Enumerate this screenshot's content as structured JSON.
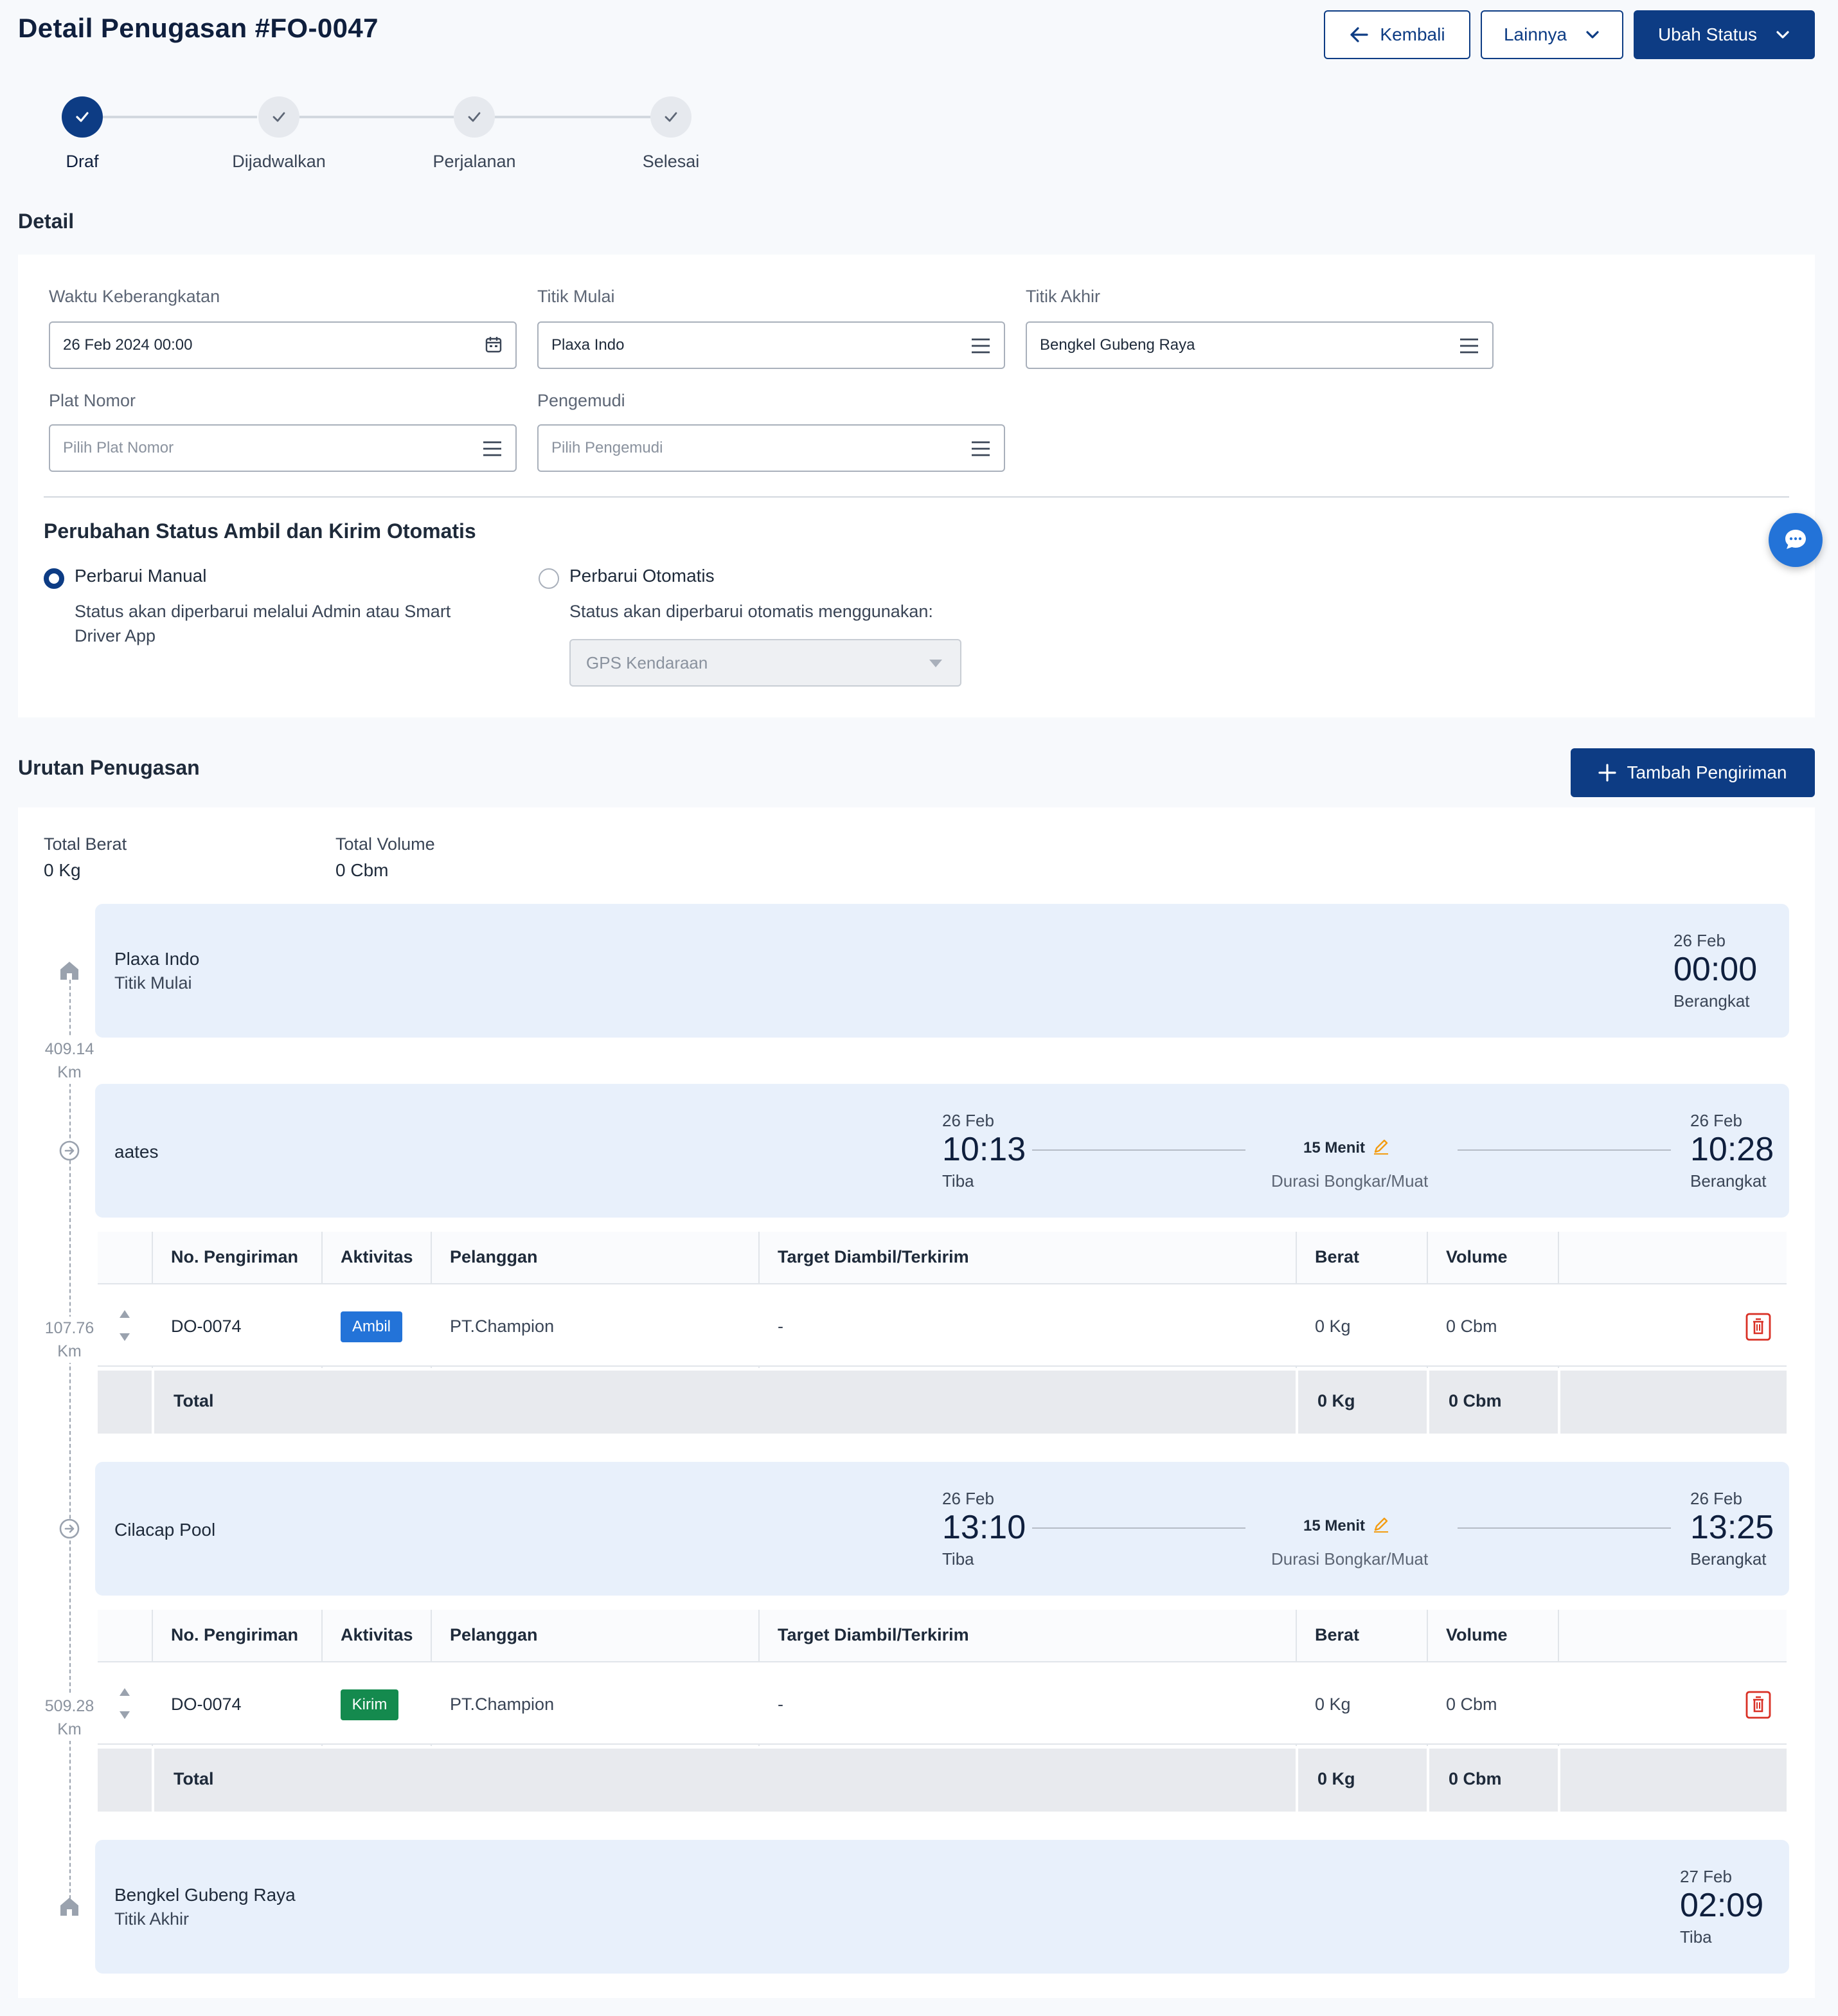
{
  "page": {
    "title": "Detail Penugasan #FO-0047"
  },
  "header_actions": {
    "back": "Kembali",
    "more": "Lainnya",
    "change_status": "Ubah Status"
  },
  "steps": [
    "Draf",
    "Dijadwalkan",
    "Perjalanan",
    "Selesai"
  ],
  "detail": {
    "section_title": "Detail",
    "departure_label": "Waktu Keberangkatan",
    "departure_value": "26 Feb 2024 00:00",
    "start_label": "Titik Mulai",
    "start_value": "Plaxa Indo",
    "end_label": "Titik Akhir",
    "end_value": "Bengkel Gubeng Raya",
    "plate_label": "Plat Nomor",
    "plate_placeholder": "Pilih Plat Nomor",
    "driver_label": "Pengemudi",
    "driver_placeholder": "Pilih Pengemudi"
  },
  "auto_status": {
    "title": "Perubahan Status Ambil dan Kirim Otomatis",
    "manual_label": "Perbarui Manual",
    "manual_desc_1": "Status akan diperbarui melalui Admin atau Smart",
    "manual_desc_2": "Driver App",
    "auto_label": "Perbarui Otomatis",
    "auto_desc": "Status akan diperbarui otomatis menggunakan:",
    "auto_select": "GPS Kendaraan",
    "selected": "manual"
  },
  "sequence": {
    "title": "Urutan Penugasan",
    "add_button": "Tambah Pengiriman",
    "total_weight_label": "Total Berat",
    "total_weight_value": "0 Kg",
    "total_volume_label": "Total Volume",
    "total_volume_value": "0 Cbm",
    "start": {
      "name": "Plaxa Indo",
      "sub": "Titik Mulai",
      "date": "26 Feb",
      "time": "00:00",
      "status": "Berangkat"
    },
    "distances": [
      "409.14",
      "107.76",
      "509.28"
    ],
    "km_unit": "Km",
    "stops": [
      {
        "name": "aates",
        "arr_date": "26 Feb",
        "arr_time": "10:13",
        "arr_label": "Tiba",
        "duration": "15 Menit",
        "duration_label": "Durasi Bongkar/Muat",
        "dep_date": "26 Feb",
        "dep_time": "10:28",
        "dep_label": "Berangkat",
        "row": {
          "no": "DO-0074",
          "activity": "Ambil",
          "customer": "PT.Champion",
          "target": "-",
          "weight": "0 Kg",
          "volume": "0 Cbm"
        },
        "total": {
          "label": "Total",
          "weight": "0 Kg",
          "volume": "0 Cbm"
        }
      },
      {
        "name": "Cilacap Pool",
        "arr_date": "26 Feb",
        "arr_time": "13:10",
        "arr_label": "Tiba",
        "duration": "15 Menit",
        "duration_label": "Durasi Bongkar/Muat",
        "dep_date": "26 Feb",
        "dep_time": "13:25",
        "dep_label": "Berangkat",
        "row": {
          "no": "DO-0074",
          "activity": "Kirim",
          "customer": "PT.Champion",
          "target": "-",
          "weight": "0 Kg",
          "volume": "0 Cbm"
        },
        "total": {
          "label": "Total",
          "weight": "0 Kg",
          "volume": "0 Cbm"
        }
      }
    ],
    "columns": [
      "No. Pengiriman",
      "Aktivitas",
      "Pelanggan",
      "Target Diambil/Terkirim",
      "Berat",
      "Volume"
    ],
    "end": {
      "name": "Bengkel Gubeng Raya",
      "sub": "Titik Akhir",
      "date": "27 Feb",
      "time": "02:09",
      "status": "Tiba"
    }
  },
  "colors": {
    "primary": "#0d3c84",
    "ambil": "#2373d8",
    "kirim": "#148a4e",
    "delete": "#d93025",
    "edit": "#f39c12"
  }
}
